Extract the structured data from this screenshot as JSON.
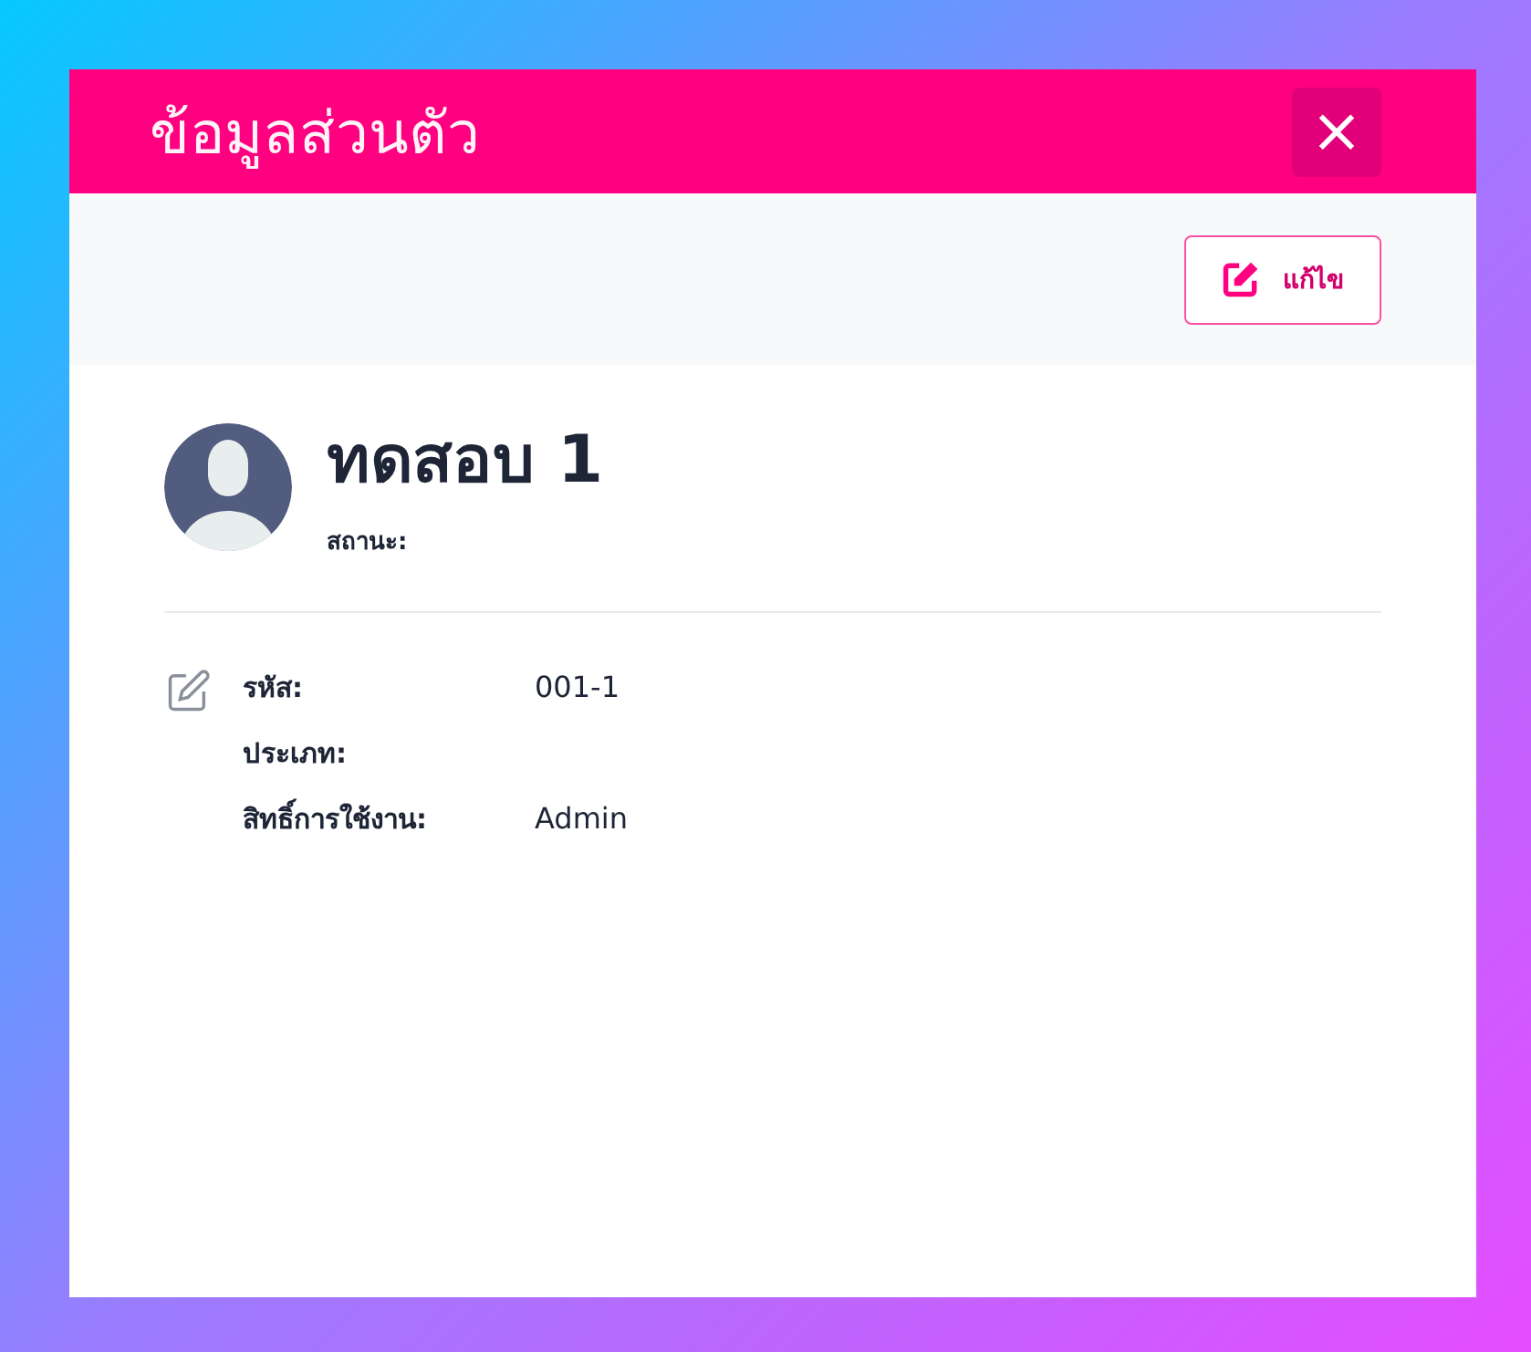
{
  "modal": {
    "title": "ข้อมูลส่วนตัว",
    "close": "×"
  },
  "toolbar": {
    "edit_button": "แก้ไข"
  },
  "profile": {
    "name": "ทดสอบ 1",
    "status_label": "สถานะ:"
  },
  "fields": [
    {
      "label": "รหัส:",
      "value": "001-1"
    },
    {
      "label": "ประเภท:"
    },
    {
      "label": "สิทธิ์การใช้งาน:",
      "value": "Admin"
    }
  ]
}
